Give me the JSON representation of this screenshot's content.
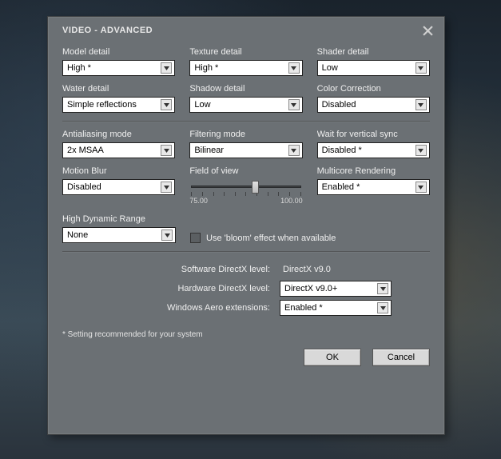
{
  "window": {
    "title": "VIDEO - ADVANCED"
  },
  "fields": {
    "model_detail": {
      "label": "Model detail",
      "value": "High *"
    },
    "texture_detail": {
      "label": "Texture detail",
      "value": "High *"
    },
    "shader_detail": {
      "label": "Shader detail",
      "value": "Low"
    },
    "water_detail": {
      "label": "Water detail",
      "value": "Simple reflections"
    },
    "shadow_detail": {
      "label": "Shadow detail",
      "value": "Low"
    },
    "color_corr": {
      "label": "Color Correction",
      "value": "Disabled"
    },
    "aa_mode": {
      "label": "Antialiasing mode",
      "value": "2x MSAA"
    },
    "filter_mode": {
      "label": "Filtering mode",
      "value": "Bilinear"
    },
    "vsync": {
      "label": "Wait for vertical sync",
      "value": "Disabled *"
    },
    "motion_blur": {
      "label": "Motion Blur",
      "value": "Disabled"
    },
    "fov": {
      "label": "Field of view",
      "min": "75.00",
      "max": "100.00",
      "value_pct": 58
    },
    "multicore": {
      "label": "Multicore Rendering",
      "value": "Enabled *"
    },
    "hdr": {
      "label": "High Dynamic Range",
      "value": "None"
    },
    "bloom": {
      "label": "Use 'bloom' effect when available",
      "checked": false
    }
  },
  "directx": {
    "software_label": "Software DirectX level:",
    "software_value": "DirectX v9.0",
    "hardware_label": "Hardware DirectX level:",
    "hardware_value": "DirectX v9.0+",
    "aero_label": "Windows Aero extensions:",
    "aero_value": "Enabled *"
  },
  "footnote": "* Setting recommended for your system",
  "buttons": {
    "ok": "OK",
    "cancel": "Cancel"
  }
}
